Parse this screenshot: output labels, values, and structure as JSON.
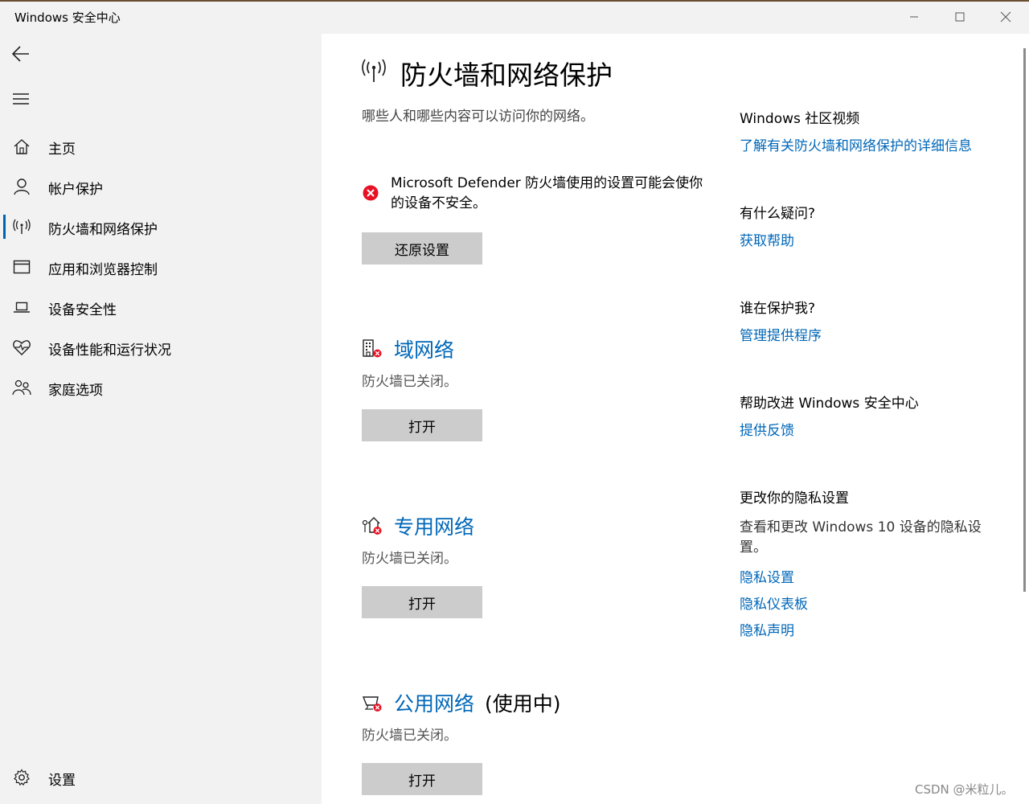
{
  "window": {
    "title": "Windows 安全中心"
  },
  "sidebar": {
    "items": [
      {
        "label": "主页",
        "icon": "home-icon"
      },
      {
        "label": "帐户保护",
        "icon": "person-icon"
      },
      {
        "label": "防火墙和网络保护",
        "icon": "wireless-icon",
        "active": true
      },
      {
        "label": "应用和浏览器控制",
        "icon": "browser-window-icon"
      },
      {
        "label": "设备安全性",
        "icon": "laptop-icon"
      },
      {
        "label": "设备性能和运行状况",
        "icon": "heart-pulse-icon"
      },
      {
        "label": "家庭选项",
        "icon": "family-icon"
      }
    ],
    "settings_label": "设置"
  },
  "main": {
    "title": "防火墙和网络保护",
    "subtitle": "哪些人和哪些内容可以访问你的网络。",
    "alert": {
      "text": "Microsoft Defender 防火墙使用的设置可能会使你的设备不安全。",
      "button": "还原设置",
      "color": "#e81123"
    },
    "networks": [
      {
        "name": "域网络",
        "suffix": "",
        "status": "防火墙已关闭。",
        "button": "打开",
        "icon": "domain-network-icon"
      },
      {
        "name": "专用网络",
        "suffix": "",
        "status": "防火墙已关闭。",
        "button": "打开",
        "icon": "private-network-icon"
      },
      {
        "name": "公用网络",
        "suffix": "(使用中)",
        "status": "防火墙已关闭。",
        "button": "打开",
        "icon": "public-network-icon"
      }
    ]
  },
  "right_panel": {
    "community": {
      "heading": "Windows 社区视频",
      "link": "了解有关防火墙和网络保护的详细信息"
    },
    "question": {
      "heading": "有什么疑问?",
      "link": "获取帮助"
    },
    "protector": {
      "heading": "谁在保护我?",
      "link": "管理提供程序"
    },
    "improve": {
      "heading": "帮助改进 Windows 安全中心",
      "link": "提供反馈"
    },
    "privacy": {
      "heading": "更改你的隐私设置",
      "text": "查看和更改 Windows 10 设备的隐私设置。",
      "links": [
        "隐私设置",
        "隐私仪表板",
        "隐私声明"
      ]
    }
  },
  "watermark": "CSDN @米粒儿。",
  "colors": {
    "accent": "#0067b8",
    "sidebar_bg": "#f2f2f2",
    "button_bg": "#cccccc",
    "error": "#e81123"
  }
}
